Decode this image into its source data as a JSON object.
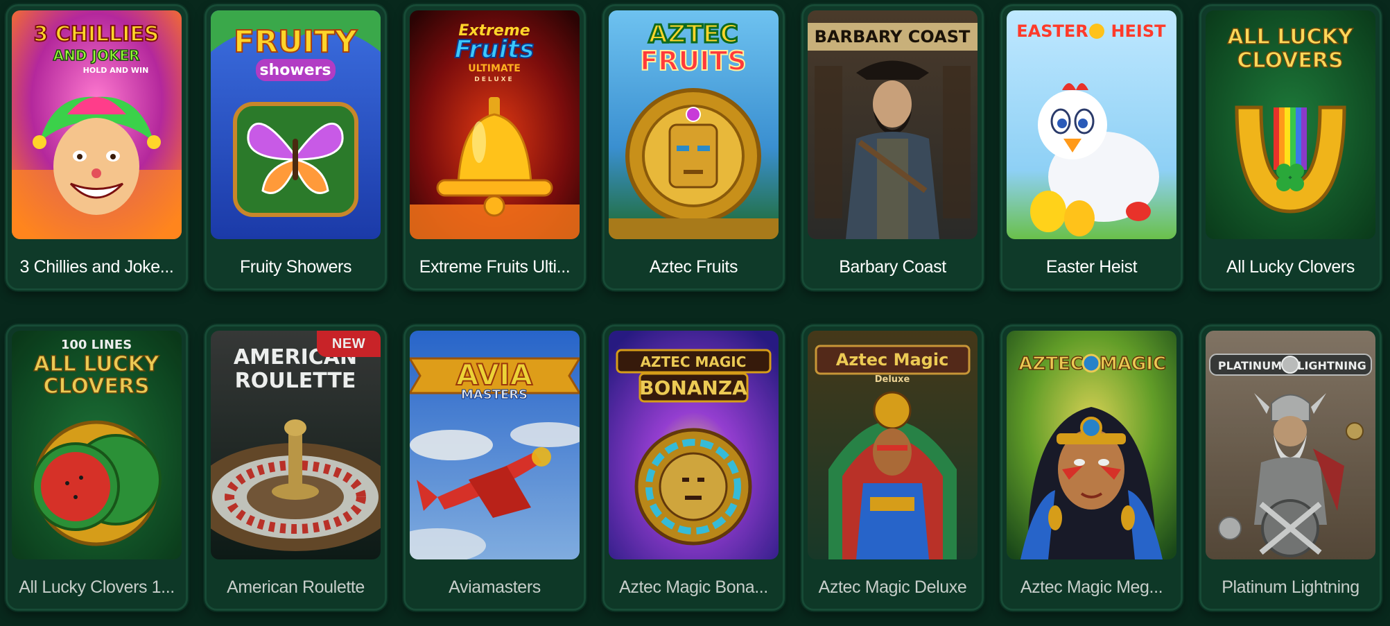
{
  "games": {
    "row1": [
      {
        "name": "3 Chillies and Joke...",
        "art_text": "3 CHILLIES",
        "art_text2": "AND JOKER",
        "art_text3": "HOLD AND WIN"
      },
      {
        "name": "Fruity Showers",
        "art_text": "FRUITY",
        "art_text2": "showers"
      },
      {
        "name": "Extreme Fruits Ulti...",
        "art_text": "Extreme",
        "art_text2": "Fruits",
        "art_text3": "ULTIMATE",
        "art_text4": "DELUXE"
      },
      {
        "name": "Aztec Fruits",
        "art_text": "AZTEC",
        "art_text2": "FRUITS"
      },
      {
        "name": "Barbary Coast",
        "art_text": "BARBARY COAST"
      },
      {
        "name": "Easter Heist",
        "art_text": "EASTER",
        "art_text2": "HEIST"
      },
      {
        "name": "All Lucky Clovers",
        "art_text": "ALL LUCKY",
        "art_text2": "CLOVERS"
      }
    ],
    "row2": [
      {
        "name": "All Lucky Clovers 1...",
        "art_text": "100 LINES",
        "art_text2": "ALL LUCKY",
        "art_text3": "CLOVERS"
      },
      {
        "name": "American Roulette",
        "art_text": "AMERICAN",
        "art_text2": "ROULETTE",
        "badge": "NEW"
      },
      {
        "name": "Aviamasters",
        "art_text": "AVIA",
        "art_text2": "MASTERS"
      },
      {
        "name": "Aztec Magic Bona...",
        "art_text": "AZTEC MAGIC",
        "art_text2": "BONANZA"
      },
      {
        "name": "Aztec Magic Deluxe",
        "art_text": "Aztec Magic",
        "art_text2": "Deluxe"
      },
      {
        "name": "Aztec Magic Meg...",
        "art_text": "AZTEC",
        "art_text2": "MAGIC"
      },
      {
        "name": "Platinum Lightning",
        "art_text": "PLATINUM",
        "art_text2": "LIGHTNING"
      }
    ]
  },
  "theme": {
    "background": "#08281c",
    "card": "#0f3a29",
    "badge": "#d8232a"
  }
}
